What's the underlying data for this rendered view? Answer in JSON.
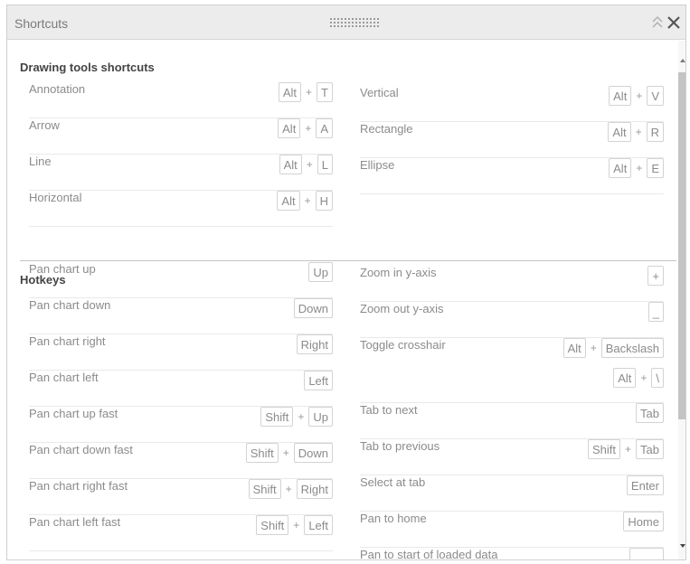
{
  "window": {
    "title": "Shortcuts"
  },
  "icons": {
    "grip": "drag-grip-icon",
    "collapse": "collapse-icon",
    "close": "close-icon",
    "scroll_up": "scroll-up-arrow-icon",
    "scroll_down": "scroll-down-arrow-icon"
  },
  "colors": {
    "titlebar_bg": "#ececec",
    "scroll_thumb": "#c4c4c4",
    "key_border": "#d3d3d3",
    "label_text": "#8b8b8b"
  },
  "sections": {
    "drawing": "Drawing tools shortcuts",
    "hotkeys": "Hotkeys"
  },
  "drawing_left": [
    {
      "label": "Annotation",
      "keys": [
        "Alt",
        "T"
      ]
    },
    {
      "label": "Arrow",
      "keys": [
        "Alt",
        "A"
      ]
    },
    {
      "label": "Line",
      "keys": [
        "Alt",
        "L"
      ]
    },
    {
      "label": "Horizontal",
      "keys": [
        "Alt",
        "H"
      ]
    }
  ],
  "drawing_right": [
    {
      "label": "Vertical",
      "keys": [
        "Alt",
        "V"
      ]
    },
    {
      "label": "Rectangle",
      "keys": [
        "Alt",
        "R"
      ]
    },
    {
      "label": "Ellipse",
      "keys": [
        "Alt",
        "E"
      ]
    }
  ],
  "hotkeys_left": [
    {
      "label": "Pan chart up",
      "keys": [
        "Up"
      ]
    },
    {
      "label": "Pan chart down",
      "keys": [
        "Down"
      ]
    },
    {
      "label": "Pan chart right",
      "keys": [
        "Right"
      ]
    },
    {
      "label": "Pan chart left",
      "keys": [
        "Left"
      ]
    },
    {
      "label": "Pan chart up fast",
      "keys": [
        "Shift",
        "Up"
      ]
    },
    {
      "label": "Pan chart down fast",
      "keys": [
        "Shift",
        "Down"
      ]
    },
    {
      "label": "Pan chart right fast",
      "keys": [
        "Shift",
        "Right"
      ]
    },
    {
      "label": "Pan chart left fast",
      "keys": [
        "Shift",
        "Left"
      ]
    }
  ],
  "hotkeys_right": [
    {
      "label": "Zoom in y-axis",
      "keys": [
        "+"
      ]
    },
    {
      "label": "Zoom out y-axis",
      "keys": [
        "_"
      ]
    },
    {
      "label": "Toggle crosshair",
      "keys": [
        "Alt",
        "Backslash"
      ],
      "alt_keys": [
        "Alt",
        "\\"
      ]
    },
    {
      "label": "Tab to next",
      "keys": [
        "Tab"
      ]
    },
    {
      "label": "Tab to previous",
      "keys": [
        "Shift",
        "Tab"
      ]
    },
    {
      "label": "Select at tab",
      "keys": [
        "Enter"
      ]
    },
    {
      "label": "Pan to home",
      "keys": [
        "Home"
      ]
    },
    {
      "label": "Pan to start of loaded data",
      "keys": [
        ""
      ]
    }
  ]
}
